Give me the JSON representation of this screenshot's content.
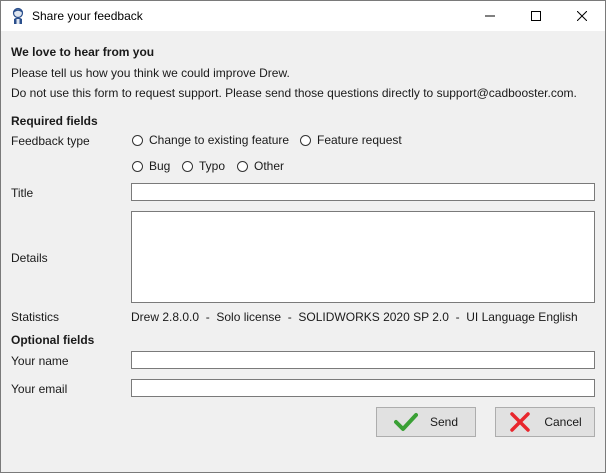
{
  "window": {
    "title": "Share your feedback"
  },
  "intro": {
    "heading": "We love to hear from you",
    "line1": "Please tell us how you think we could improve Drew.",
    "line2": "Do not use this form to request support. Please send those questions directly to support@cadbooster.com."
  },
  "required": {
    "heading": "Required fields",
    "feedback_type_label": "Feedback type",
    "options": [
      "Change to existing feature",
      "Feature request",
      "Bug",
      "Typo",
      "Other"
    ],
    "title_label": "Title",
    "title_value": "",
    "details_label": "Details",
    "details_value": "",
    "statistics_label": "Statistics",
    "statistics_value": "Drew 2.8.0.0  -  Solo license  -  SOLIDWORKS 2020 SP 2.0  -  UI Language English"
  },
  "optional": {
    "heading": "Optional fields",
    "name_label": "Your name",
    "name_value": "",
    "email_label": "Your email",
    "email_value": ""
  },
  "buttons": {
    "send": "Send",
    "cancel": "Cancel"
  },
  "icons": {
    "app": "drew-logo-icon",
    "send": "checkmark-icon",
    "cancel": "x-icon"
  },
  "colors": {
    "send_icon": "#3aa035",
    "cancel_icon": "#e8262d"
  }
}
